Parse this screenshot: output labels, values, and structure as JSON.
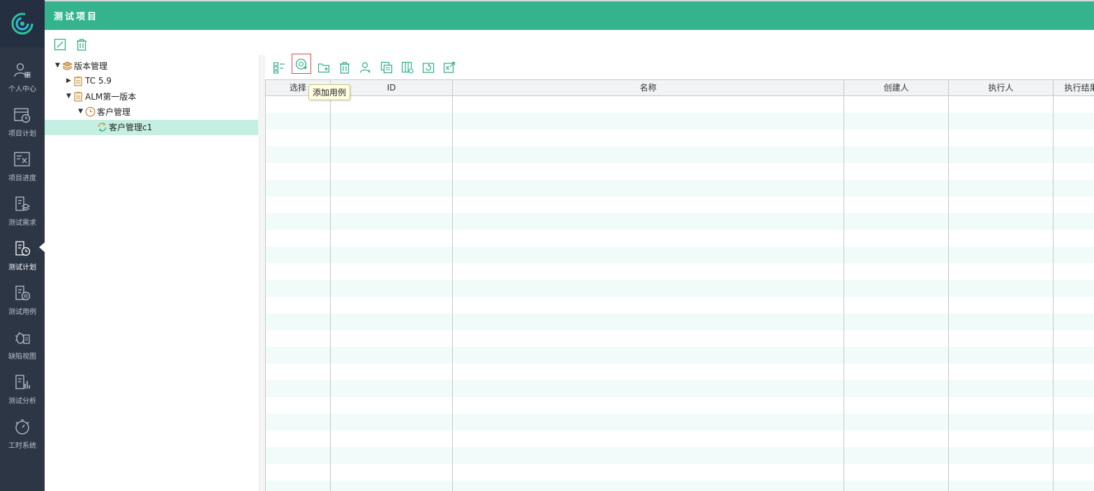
{
  "header": {
    "title": "测试项目"
  },
  "sidebar": {
    "items": [
      {
        "label": "个人中心",
        "icon": "user-grid-icon"
      },
      {
        "label": "项目计划",
        "icon": "calendar-clock-icon"
      },
      {
        "label": "项目进度",
        "icon": "chart-progress-icon"
      },
      {
        "label": "测试需求",
        "icon": "doc-layers-icon"
      },
      {
        "label": "测试计划",
        "icon": "doc-clock-icon",
        "active": true
      },
      {
        "label": "测试用例",
        "icon": "doc-gear-icon"
      },
      {
        "label": "缺陷视图",
        "icon": "bug-icon"
      },
      {
        "label": "测试分析",
        "icon": "doc-chart-icon"
      },
      {
        "label": "工时系统",
        "icon": "stopwatch-icon"
      }
    ]
  },
  "tree_toolbar": {
    "edit_icon": "edit-icon",
    "delete_icon": "trash-icon"
  },
  "tree": {
    "nodes": [
      {
        "label": "版本管理",
        "level": 0,
        "toggle": "▼",
        "icon": "stack-icon"
      },
      {
        "label": "TC 5.9",
        "level": 1,
        "toggle": "▶",
        "icon": "clipboard-icon"
      },
      {
        "label": "ALM第一版本",
        "level": 1,
        "toggle": "▼",
        "icon": "clipboard-icon"
      },
      {
        "label": "客户管理",
        "level": 2,
        "toggle": "▼",
        "icon": "clock-icon"
      },
      {
        "label": "客户管理c1",
        "level": 3,
        "toggle": "",
        "icon": "cycle-icon",
        "selected": true
      }
    ]
  },
  "grid_toolbar": {
    "buttons": [
      "tree-view-icon",
      "add-case-icon",
      "add-folder-icon",
      "delete-icon",
      "assign-user-icon",
      "copy-icon",
      "columns-icon",
      "refresh-icon",
      "export-icon"
    ],
    "tooltip": "添加用例"
  },
  "grid": {
    "columns": [
      "选择",
      "ID",
      "名称",
      "创建人",
      "执行人",
      "执行结果"
    ],
    "rows": []
  },
  "colors": {
    "accent": "#35b38f",
    "sidebar": "#2c3644",
    "selected_row": "#c5efe2",
    "alt_row": "#f0fbfa"
  }
}
